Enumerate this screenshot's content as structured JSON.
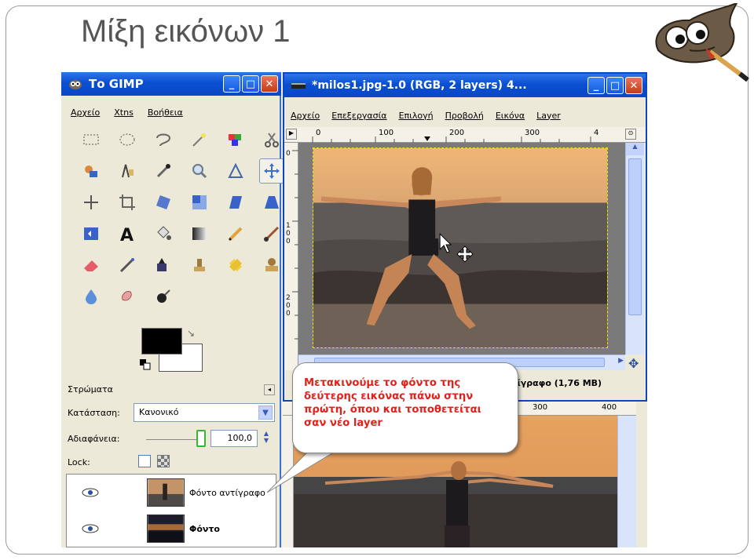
{
  "slide": {
    "title": "Μίξη εικόνων 1"
  },
  "toolbox": {
    "title": "Το GIMP",
    "menu": [
      "Αρχείο",
      "Xtns",
      "Βοήθεια"
    ],
    "layers_label": "Στρώματα",
    "mode_label": "Κατάσταση:",
    "mode_value": "Κανονικό",
    "opacity_label": "Αδιαφάνεια:",
    "opacity_value": "100,0",
    "lock_label": "Lock:",
    "layers": [
      {
        "name": "Φόντο αντίγραφο",
        "bold": false
      },
      {
        "name": "Φόντο",
        "bold": true
      }
    ]
  },
  "image_window": {
    "title": "*milos1.jpg-1.0 (RGB, 2 layers) 4...",
    "menu": [
      "Αρχείο",
      "Επεξεργασία",
      "Επιλογή",
      "Προβολή",
      "Εικόνα",
      "Layer"
    ],
    "ruler_ticks": [
      "0",
      "100",
      "200",
      "300",
      "4"
    ],
    "status": "ντίγραφο (1,76 MB)"
  },
  "back_window": {
    "ruler_ticks": [
      "300",
      "400"
    ]
  },
  "callout": {
    "text": "Μετακινούμε το φόντο της δεύτερης εικόνας πάνω στην πρώτη, όπου και τοποθετείται σαν νέο layer"
  },
  "colors": {
    "xp_blue": "#0a4fd2",
    "callout_text": "#e0221b",
    "panel": "#ece9d8"
  }
}
